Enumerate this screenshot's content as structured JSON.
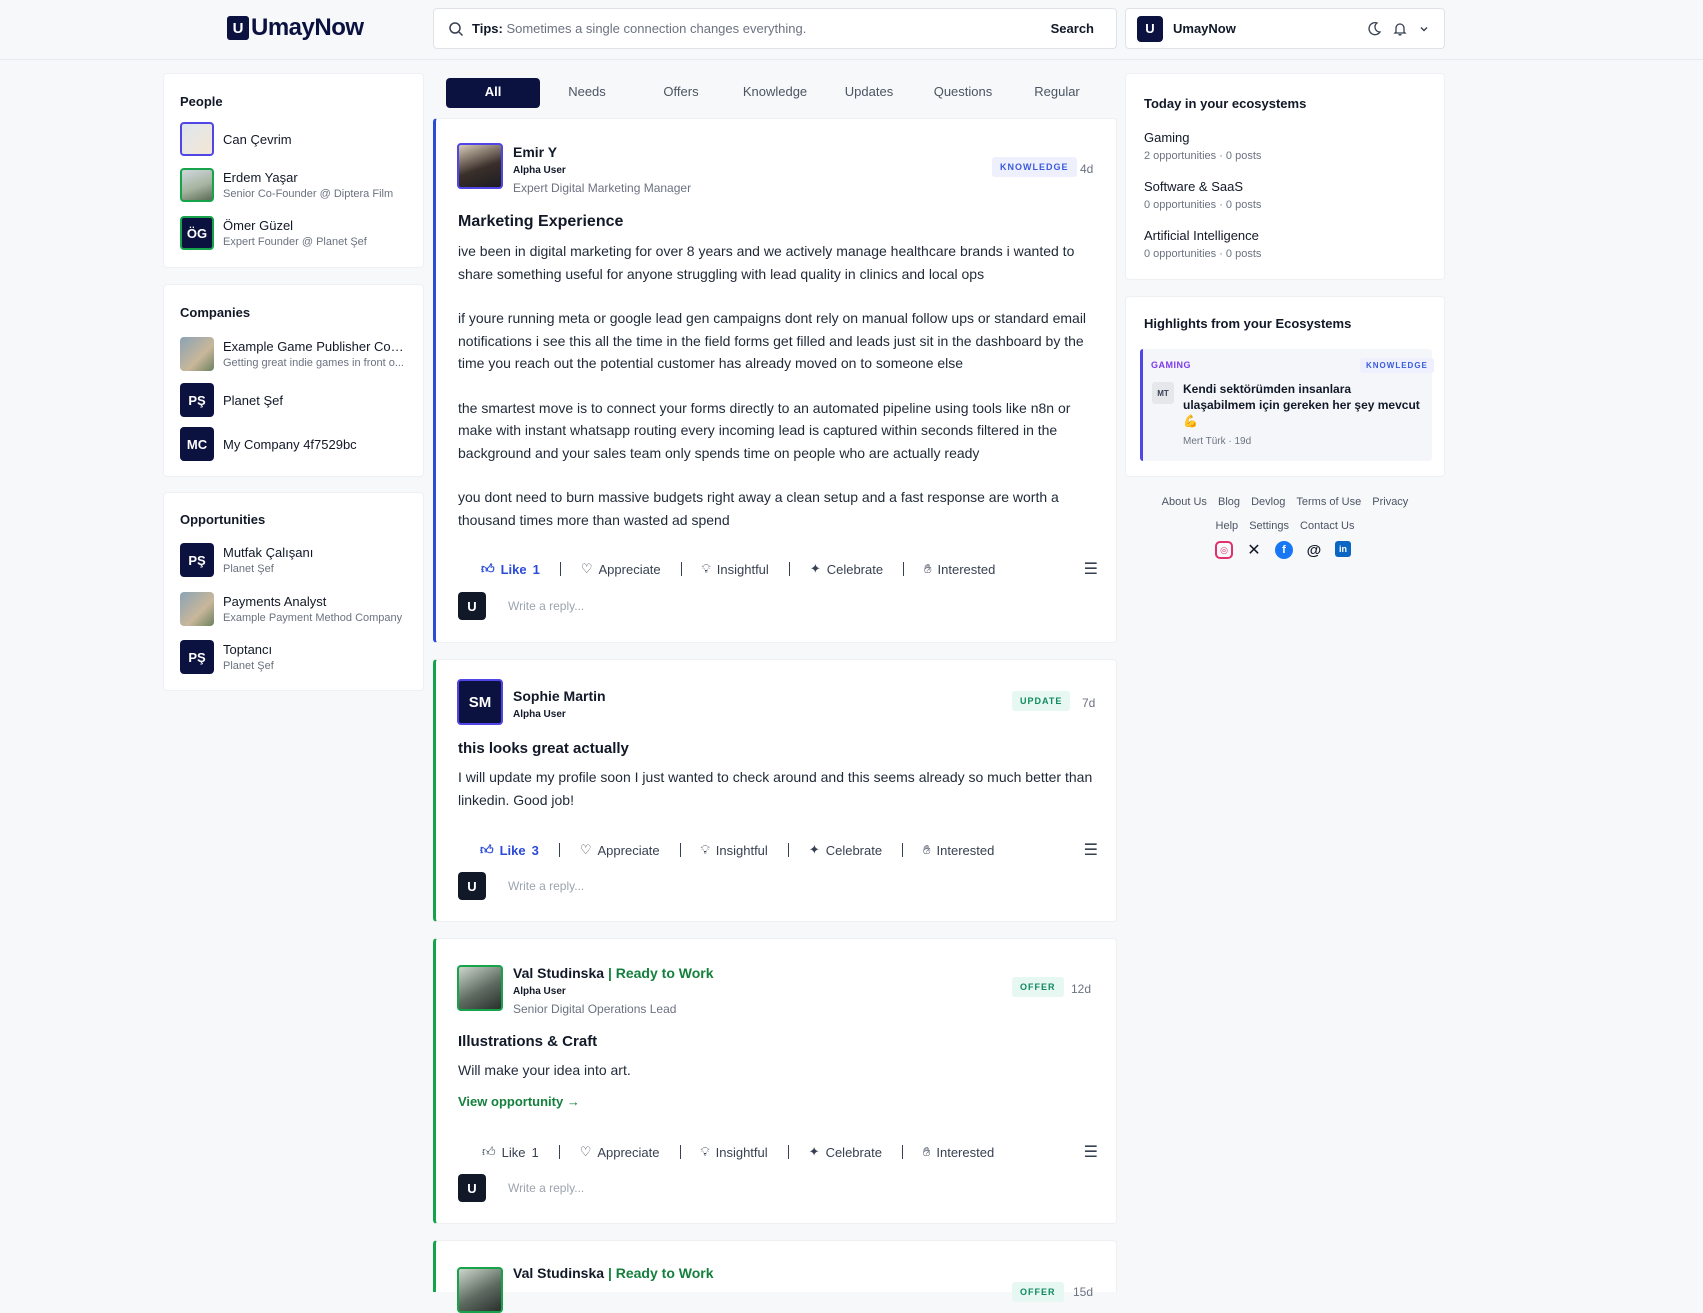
{
  "brand": {
    "name": "UmayNow",
    "mark": "U"
  },
  "search": {
    "tips_label": "Tips:",
    "tips_text": "Sometimes a single connection changes everything.",
    "button": "Search"
  },
  "account": {
    "name": "UmayNow"
  },
  "people": {
    "title": "People",
    "items": [
      {
        "name": "Can Çevrim",
        "sub": ""
      },
      {
        "name": "Erdem Yaşar",
        "sub": "Senior Co-Founder @ Diptera Film"
      },
      {
        "name": "Ömer Güzel",
        "sub": "Expert Founder @ Planet Şef",
        "initials": "ÖG"
      }
    ]
  },
  "companies": {
    "title": "Companies",
    "items": [
      {
        "name": "Example Game Publisher Com...",
        "sub": "Getting great indie games in front o..."
      },
      {
        "name": "Planet Şef",
        "initials": "PŞ"
      },
      {
        "name": "My Company 4f7529bc",
        "initials": "MC"
      }
    ]
  },
  "opportunities": {
    "title": "Opportunities",
    "items": [
      {
        "name": "Mutfak Çalışanı",
        "sub": "Planet Şef",
        "initials": "PŞ"
      },
      {
        "name": "Payments Analyst",
        "sub": "Example Payment Method Company"
      },
      {
        "name": "Toptancı",
        "sub": "Planet Şef",
        "initials": "PŞ"
      }
    ]
  },
  "tabs": [
    "All",
    "Needs",
    "Offers",
    "Knowledge",
    "Updates",
    "Questions",
    "Regular"
  ],
  "posts": [
    {
      "name": "Emir Y",
      "role": "Alpha User",
      "title": "Expert Digital Marketing Manager",
      "badge": "KNOWLEDGE",
      "ago": "4d",
      "heading": "Marketing Experience",
      "paragraphs": [
        "ive been in digital marketing for over 8 years and we actively manage healthcare brands i wanted to share something useful for anyone struggling with lead quality in clinics and local ops",
        "if youre running meta or google lead gen campaigns dont rely on manual follow ups or standard email notifications i see this all the time in the field forms get filled and leads just sit in the dashboard by the time you reach out the potential customer has already moved on to someone else",
        "the smartest move is to connect your forms directly to an automated pipeline using tools like n8n or make with instant whatsapp routing every incoming lead is captured within seconds filtered in the background and your sales team only spends time on people who are actually ready",
        "you dont need to burn massive budgets right away a clean setup and a fast response are worth a thousand times more than wasted ad spend"
      ],
      "like": "Like",
      "like_count": "1"
    },
    {
      "name": "Sophie Martin",
      "initials": "SM",
      "role": "Alpha User",
      "badge": "UPDATE",
      "ago": "7d",
      "heading": "this looks great actually",
      "body": "I will update my profile soon I just wanted to check around and this seems already so much better than linkedin. Good job!",
      "like": "Like",
      "like_count": "3"
    },
    {
      "name": "Val Studinska",
      "status": "| Ready to Work",
      "role": "Alpha User",
      "title": "Senior Digital Operations Lead",
      "badge": "OFFER",
      "ago": "12d",
      "heading": "Illustrations & Craft",
      "body": "Will make your idea into art.",
      "link": "View opportunity →",
      "like": "Like",
      "like_count": "1"
    },
    {
      "name": "Val Studinska",
      "status": "| Ready to Work",
      "badge": "OFFER",
      "ago": "15d"
    }
  ],
  "actions": {
    "appreciate": "Appreciate",
    "insightful": "Insightful",
    "celebrate": "Celebrate",
    "interested": "Interested"
  },
  "reply_placeholder": "Write a reply...",
  "today": {
    "title": "Today in your ecosystems",
    "items": [
      {
        "name": "Gaming",
        "stats": "2 opportunities · 0 posts"
      },
      {
        "name": "Software & SaaS",
        "stats": "0 opportunities · 0 posts"
      },
      {
        "name": "Artificial Intelligence",
        "stats": "0 opportunities · 0 posts"
      }
    ]
  },
  "highlights": {
    "title": "Highlights from your Ecosystems",
    "item": {
      "category": "GAMING",
      "badge": "KNOWLEDGE",
      "avatar": "MT",
      "text": "Kendi sektörümden insanlara ulaşabilmem için gereken her şey mevcut 💪",
      "author": "Mert Türk",
      "ago": "19d"
    }
  },
  "footer": {
    "links1": [
      "About Us",
      "Blog",
      "Devlog",
      "Terms of Use",
      "Privacy"
    ],
    "links2": [
      "Help",
      "Settings",
      "Contact Us"
    ],
    "social": [
      "instagram-icon",
      "x-icon",
      "facebook-icon",
      "threads-icon",
      "linkedin-icon"
    ]
  },
  "colors": {
    "brand": "#0b1240",
    "accent": "#2b4bd8",
    "green": "#15803d",
    "purple": "#4f46e5"
  }
}
